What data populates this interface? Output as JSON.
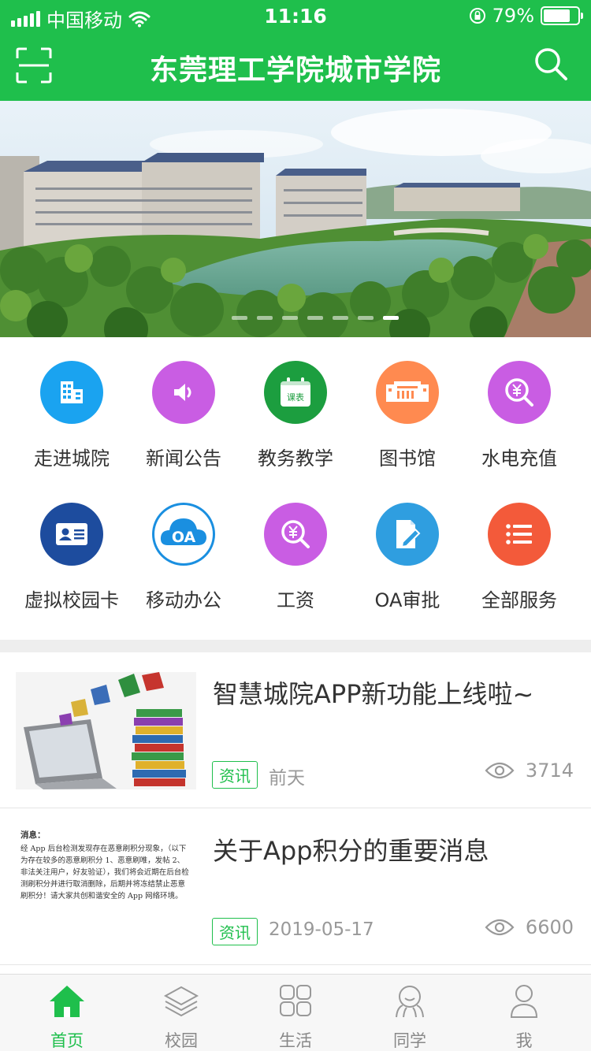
{
  "status_bar": {
    "carrier": "中国移动",
    "time": "11:16",
    "battery_text": "79%",
    "battery_level": 0.79
  },
  "header": {
    "title": "东莞理工学院城市学院",
    "left_icon": "scan-icon",
    "right_icon": "search-icon"
  },
  "banner": {
    "slide_count": 7,
    "active_index": 6
  },
  "services": [
    {
      "label": "走进城院",
      "icon": "building-icon",
      "color": "#1aa3f0"
    },
    {
      "label": "新闻公告",
      "icon": "speaker-icon",
      "color": "#c95de3"
    },
    {
      "label": "教务教学",
      "icon": "calendar-icon",
      "color": "#1c9e3f",
      "badge": "课表"
    },
    {
      "label": "图书馆",
      "icon": "library-icon",
      "color": "#ff8a50"
    },
    {
      "label": "水电充值",
      "icon": "yen-search-icon",
      "color": "#c95de3"
    },
    {
      "label": "虚拟校园卡",
      "icon": "id-card-icon",
      "color": "#1d4c9e"
    },
    {
      "label": "移动办公",
      "icon": "oa-cloud-icon",
      "color": "#1a8fe0",
      "badge": "OA"
    },
    {
      "label": "工资",
      "icon": "yen-search-icon",
      "color": "#c95de3"
    },
    {
      "label": "OA审批",
      "icon": "approval-pen-icon",
      "color": "#2f9ee0"
    },
    {
      "label": "全部服务",
      "icon": "list-icon",
      "color": "#f35a3a"
    }
  ],
  "news": [
    {
      "title": "智慧城院APP新功能上线啦~",
      "tag": "资讯",
      "date": "前天",
      "views": "3714",
      "thumb": "books-laptop-image"
    },
    {
      "title": "关于App积分的重要消息",
      "tag": "资讯",
      "date": "2019-05-17",
      "views": "6600",
      "thumb": "notice-text-image",
      "thumb_heading": "消息：",
      "thumb_body": "经 App 后台检测发现存在恶意刷积分现象，（以下为存在较多的恶意刷积分 1、恶意刷唯，发帖 2、非法关注用户，好友验证），我们将会近期在后台检测刷积分并进行取消删除，后期并将冻结禁止恶意刷积分！请大家共创和谐安全的 App 网络环境。"
    }
  ],
  "tabbar": [
    {
      "label": "首页",
      "icon": "home-icon",
      "active": true
    },
    {
      "label": "校园",
      "icon": "layers-icon",
      "active": false
    },
    {
      "label": "生活",
      "icon": "grid-icon",
      "active": false
    },
    {
      "label": "同学",
      "icon": "classmates-icon",
      "active": false
    },
    {
      "label": "我",
      "icon": "person-icon",
      "active": false
    }
  ],
  "colors": {
    "brand": "#1fbf4c",
    "tab_inactive": "#888888",
    "meta_gray": "#999999"
  }
}
